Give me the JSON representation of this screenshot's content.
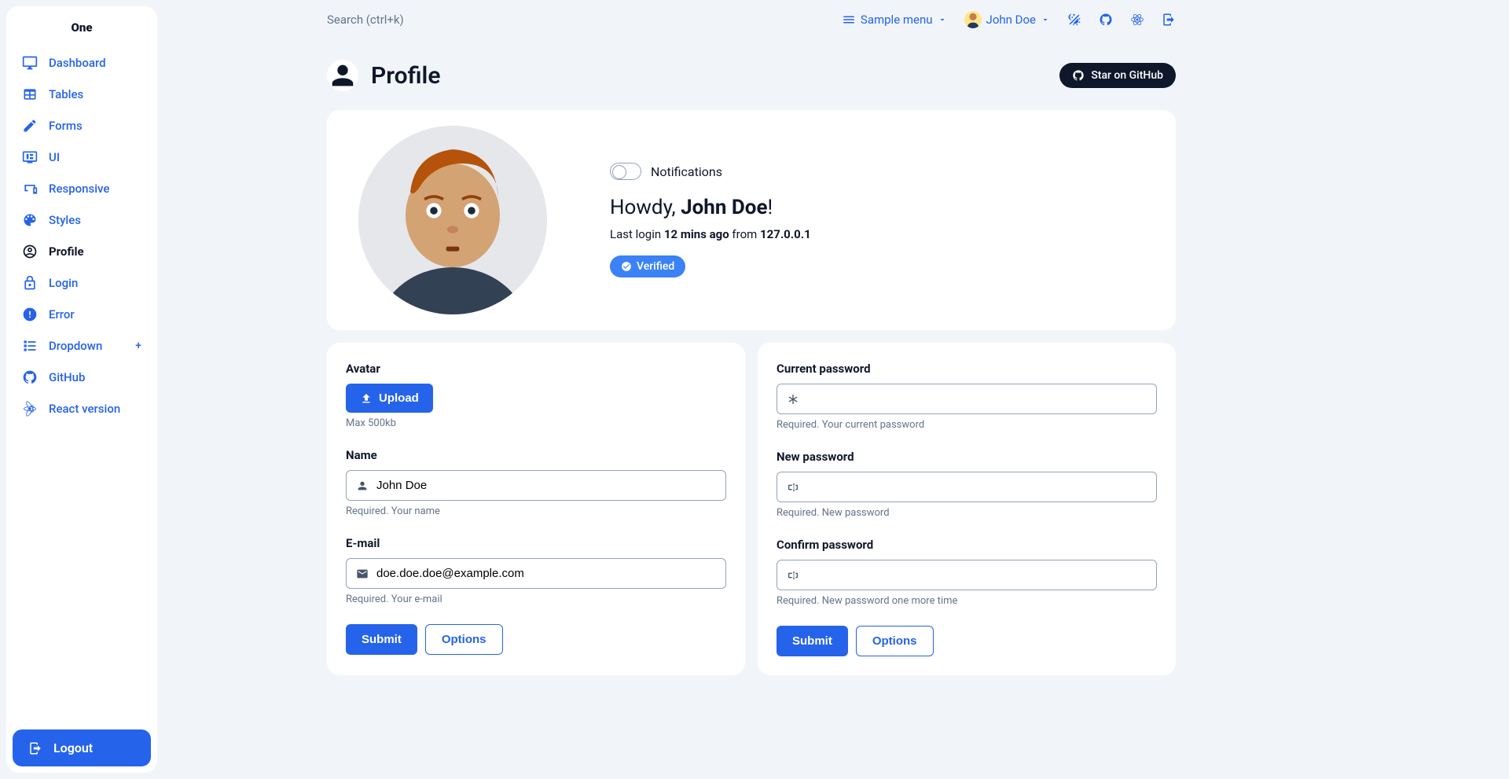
{
  "app_title": "One",
  "sidebar": {
    "items": [
      {
        "label": "Dashboard",
        "icon": "monitor"
      },
      {
        "label": "Tables",
        "icon": "table"
      },
      {
        "label": "Forms",
        "icon": "edit"
      },
      {
        "label": "UI",
        "icon": "tv"
      },
      {
        "label": "Responsive",
        "icon": "responsive"
      },
      {
        "label": "Styles",
        "icon": "palette"
      },
      {
        "label": "Profile",
        "icon": "account",
        "active": true
      },
      {
        "label": "Login",
        "icon": "lock"
      },
      {
        "label": "Error",
        "icon": "alert"
      },
      {
        "label": "Dropdown",
        "icon": "list",
        "expandable": true
      },
      {
        "label": "GitHub",
        "icon": "github"
      },
      {
        "label": "React version",
        "icon": "react"
      }
    ],
    "logout": "Logout"
  },
  "topbar": {
    "search_placeholder": "Search (ctrl+k)",
    "sample_menu": "Sample menu",
    "user_name": "John Doe"
  },
  "page": {
    "title": "Profile",
    "star_btn": "Star on GitHub"
  },
  "profile": {
    "notifications_label": "Notifications",
    "greeting_prefix": "Howdy, ",
    "greeting_name": "John Doe",
    "greeting_suffix": "!",
    "login_prefix": "Last login ",
    "login_time": "12 mins ago",
    "login_mid": " from ",
    "login_ip": "127.0.0.1",
    "badge": "Verified"
  },
  "form_left": {
    "avatar_label": "Avatar",
    "upload_btn": "Upload",
    "avatar_help": "Max 500kb",
    "name_label": "Name",
    "name_value": "John Doe",
    "name_help": "Required. Your name",
    "email_label": "E-mail",
    "email_value": "doe.doe.doe@example.com",
    "email_help": "Required. Your e-mail",
    "submit": "Submit",
    "options": "Options"
  },
  "form_right": {
    "current_label": "Current password",
    "current_help": "Required. Your current password",
    "new_label": "New password",
    "new_help": "Required. New password",
    "confirm_label": "Confirm password",
    "confirm_help": "Required. New password one more time",
    "submit": "Submit",
    "options": "Options"
  }
}
